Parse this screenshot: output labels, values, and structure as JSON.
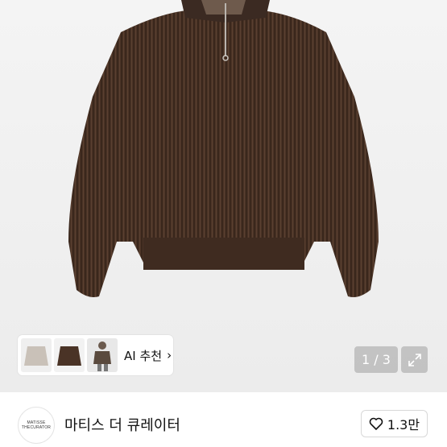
{
  "gallery": {
    "counter_text": "1 / 3",
    "icons": {
      "expand": "expand-icon"
    }
  },
  "ai_recommend": {
    "label": "AI 추천",
    "chevron": "›",
    "thumbnails": [
      "thumbnail-1",
      "thumbnail-2",
      "thumbnail-3"
    ]
  },
  "seller": {
    "logo_line1": "MATISSE",
    "logo_line2": "THECURATOR",
    "name": "마티스 더 큐레이터",
    "favorite_count": "1.3만"
  },
  "colors": {
    "sweater": "#4a3326",
    "counter_bg": "#a0a0a0"
  }
}
